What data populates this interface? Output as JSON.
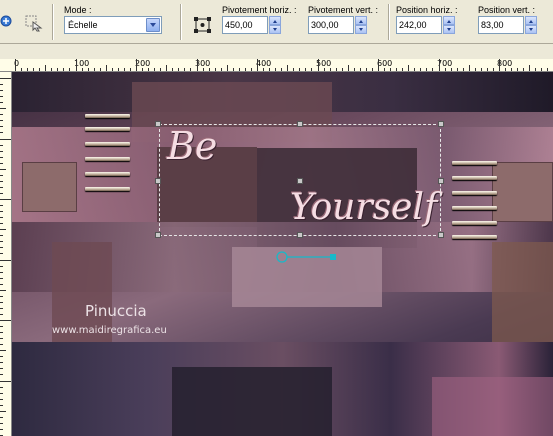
{
  "toolbar": {
    "mode": {
      "label": "Mode :",
      "value": "Échelle"
    },
    "pivot_h": {
      "label": "Pivotement horiz. :",
      "value": "450,00"
    },
    "pivot_v": {
      "label": "Pivotement vert. :",
      "value": "300,00"
    },
    "pos_h": {
      "label": "Position horiz. :",
      "value": "242,00"
    },
    "pos_v": {
      "label": "Position vert. :",
      "value": "83,00"
    }
  },
  "ruler": {
    "labels": [
      "0",
      "100",
      "200",
      "300",
      "400",
      "500",
      "600",
      "700",
      "800"
    ]
  },
  "canvas": {
    "logo_line1": "Be",
    "logo_line2": "Yourself",
    "watermark_name": "Pinuccia",
    "watermark_url": "www.maidiregrafica.eu"
  },
  "colors": {
    "accent_pink": "#f5dde3",
    "handle_cyan": "#17b9c9"
  }
}
